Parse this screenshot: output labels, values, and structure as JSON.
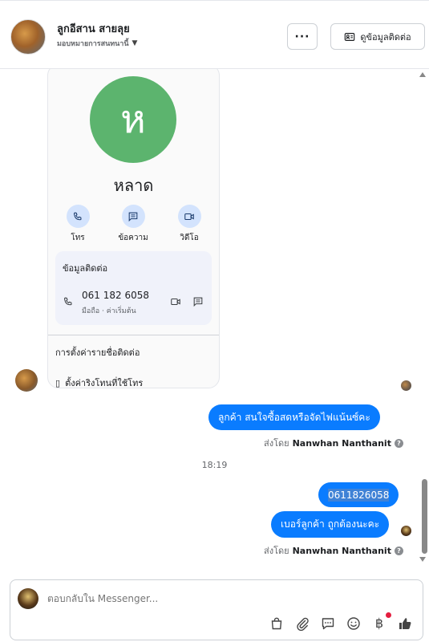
{
  "header": {
    "contact_name": "ลูกอีสาน สายลุย",
    "assign_label": "มอบหมายการสนทนานี้",
    "more_label": "···",
    "contact_info_label": "ดูข้อมูลติดต่อ"
  },
  "contact_card": {
    "initial": "ห",
    "name": "หลาด",
    "actions": [
      {
        "label": "โทร",
        "icon": "phone-icon"
      },
      {
        "label": "ข้อความ",
        "icon": "message-icon"
      },
      {
        "label": "วิดีโอ",
        "icon": "video-icon"
      }
    ],
    "info_title": "ข้อมูลติดต่อ",
    "phone_number": "061 182 6058",
    "phone_sub": "มือถือ · ค่าเริ่มต้น",
    "settings_1": "การตั้งค่ารายชื่อติดต่อ",
    "settings_2": "ตั้งค่าริงโทนที่ใช้โทร"
  },
  "messages": [
    {
      "text": "ลูกค้า สนใจซื้อสดหรือจัดไฟแน้นซ์คะ"
    },
    {
      "text": "0611826058"
    },
    {
      "text": "เบอร์ลูกค้า ถูกต้องนะคะ"
    }
  ],
  "sent_by_prefix": "ส่งโดย",
  "sender_name": "Nanwhan Nanthanit",
  "timestamp": "18:19",
  "composer": {
    "placeholder": "ตอบกลับใน Messenger...",
    "baht_symbol": "฿"
  },
  "colors": {
    "bubble": "#0a7cff",
    "avatar_green": "#5cb46e",
    "notification_dot": "#e41e3f"
  }
}
